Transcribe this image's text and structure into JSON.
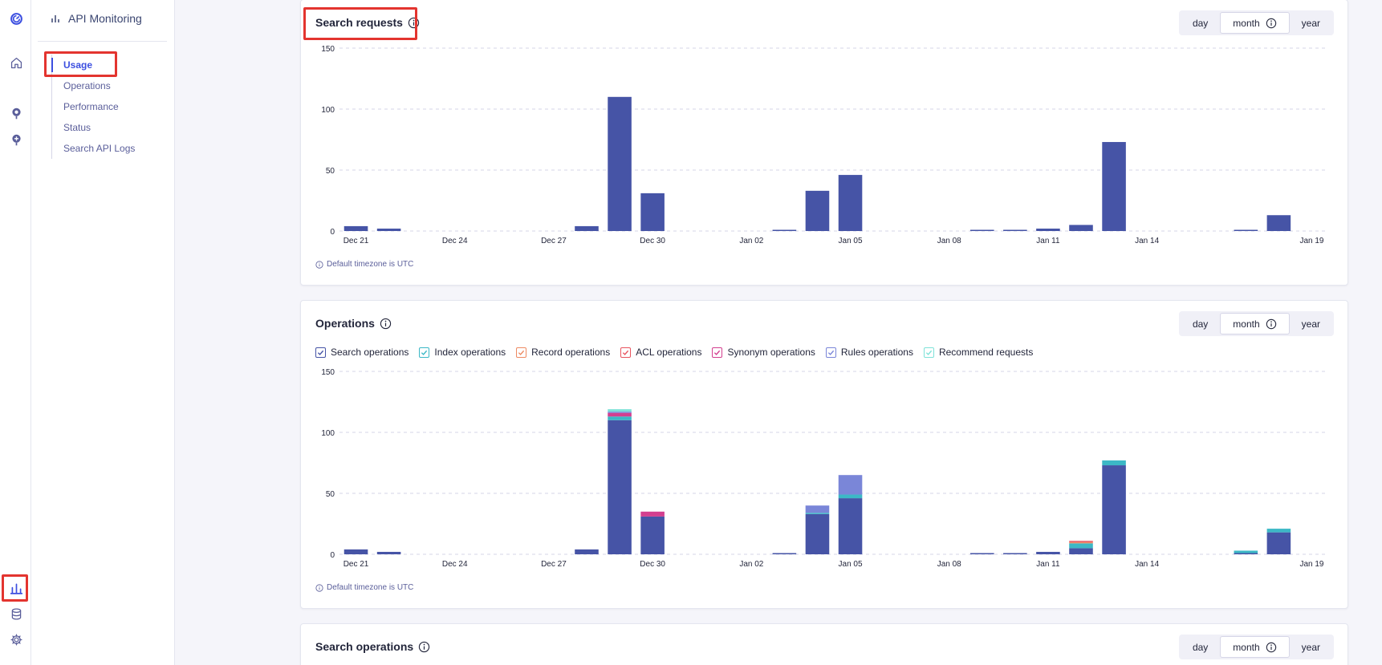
{
  "nav": {
    "title": "API Monitoring",
    "items": [
      {
        "label": "Usage",
        "active": true
      },
      {
        "label": "Operations",
        "active": false
      },
      {
        "label": "Performance",
        "active": false
      },
      {
        "label": "Status",
        "active": false
      },
      {
        "label": "Search API Logs",
        "active": false
      }
    ]
  },
  "rail": {
    "icons": [
      "algolia-logo-icon",
      "home-icon",
      "search-pin-icon",
      "add-pin-icon",
      "bar-chart-icon",
      "database-icon",
      "gear-icon"
    ],
    "active_icon": "bar-chart-icon"
  },
  "period_toggle": {
    "day": "day",
    "month": "month",
    "year": "year",
    "selected": "month"
  },
  "timezone_note": "Default timezone is UTC",
  "colors": {
    "accent": "#3c4fe0",
    "bar_primary": "#4654a6",
    "highlight_box": "#e3342f"
  },
  "cards": {
    "search_requests": {
      "title": "Search requests"
    },
    "operations": {
      "title": "Operations"
    },
    "search_operations": {
      "title": "Search operations"
    }
  },
  "legend": [
    {
      "label": "Search operations",
      "color": "#4654a6"
    },
    {
      "label": "Index operations",
      "color": "#3cb8c6"
    },
    {
      "label": "Record operations",
      "color": "#ee8a62"
    },
    {
      "label": "ACL operations",
      "color": "#e8535e"
    },
    {
      "label": "Synonym operations",
      "color": "#d33f8f"
    },
    {
      "label": "Rules operations",
      "color": "#7a86d8"
    },
    {
      "label": "Recommend requests",
      "color": "#7ee2d8"
    }
  ],
  "chart_data": [
    {
      "type": "bar",
      "title": "Search requests",
      "ylim": [
        0,
        150
      ],
      "yticks": [
        0,
        50,
        100,
        150
      ],
      "grid": true,
      "x_tick_labels": [
        "Dec 21",
        "Dec 24",
        "Dec 27",
        "Dec 30",
        "Jan 02",
        "Jan 05",
        "Jan 08",
        "Jan 11",
        "Jan 14",
        "Jan 19"
      ],
      "categories": [
        "Dec 21",
        "Dec 22",
        "Dec 23",
        "Dec 24",
        "Dec 25",
        "Dec 26",
        "Dec 27",
        "Dec 28",
        "Dec 29",
        "Dec 30",
        "Dec 31",
        "Jan 01",
        "Jan 02",
        "Jan 03",
        "Jan 04",
        "Jan 05",
        "Jan 06",
        "Jan 07",
        "Jan 08",
        "Jan 09",
        "Jan 10",
        "Jan 11",
        "Jan 12",
        "Jan 13",
        "Jan 14",
        "Jan 15",
        "Jan 16",
        "Jan 17",
        "Jan 18",
        "Jan 19"
      ],
      "series": [
        {
          "color": "#4654a6",
          "values": [
            4,
            2,
            0,
            0,
            0,
            0,
            0,
            4,
            110,
            31,
            0,
            0,
            0,
            1,
            33,
            46,
            0,
            0,
            0,
            1,
            1,
            2,
            5,
            73,
            0,
            0,
            0,
            1,
            13,
            0
          ]
        }
      ]
    },
    {
      "type": "bar",
      "title": "Operations",
      "stacked": true,
      "ylim": [
        0,
        150
      ],
      "yticks": [
        0,
        50,
        100,
        150
      ],
      "grid": true,
      "x_tick_labels": [
        "Dec 21",
        "Dec 24",
        "Dec 27",
        "Dec 30",
        "Jan 02",
        "Jan 05",
        "Jan 08",
        "Jan 11",
        "Jan 14",
        "Jan 19"
      ],
      "categories": [
        "Dec 21",
        "Dec 22",
        "Dec 23",
        "Dec 24",
        "Dec 25",
        "Dec 26",
        "Dec 27",
        "Dec 28",
        "Dec 29",
        "Dec 30",
        "Dec 31",
        "Jan 01",
        "Jan 02",
        "Jan 03",
        "Jan 04",
        "Jan 05",
        "Jan 06",
        "Jan 07",
        "Jan 08",
        "Jan 09",
        "Jan 10",
        "Jan 11",
        "Jan 12",
        "Jan 13",
        "Jan 14",
        "Jan 15",
        "Jan 16",
        "Jan 17",
        "Jan 18",
        "Jan 19"
      ],
      "series": [
        {
          "name": "Search operations",
          "color": "#4654a6",
          "values": [
            4,
            2,
            0,
            0,
            0,
            0,
            0,
            4,
            110,
            31,
            0,
            0,
            0,
            1,
            33,
            46,
            0,
            0,
            0,
            1,
            1,
            2,
            5,
            73,
            0,
            0,
            0,
            1,
            18,
            0
          ]
        },
        {
          "name": "Index operations",
          "color": "#3cb8c6",
          "values": [
            0,
            0,
            0,
            0,
            0,
            0,
            0,
            0,
            3,
            0,
            0,
            0,
            0,
            0,
            1,
            3,
            0,
            0,
            0,
            0,
            0,
            0,
            4,
            4,
            0,
            0,
            0,
            2,
            3,
            0
          ]
        },
        {
          "name": "Record operations",
          "color": "#ee8a62",
          "values": [
            0,
            0,
            0,
            0,
            0,
            0,
            0,
            0,
            0,
            0,
            0,
            0,
            0,
            0,
            0,
            0,
            0,
            0,
            0,
            0,
            0,
            0,
            1,
            0,
            0,
            0,
            0,
            0,
            0,
            0
          ]
        },
        {
          "name": "ACL operations",
          "color": "#e8535e",
          "values": [
            0,
            0,
            0,
            0,
            0,
            0,
            0,
            0,
            0,
            0,
            0,
            0,
            0,
            0,
            0,
            0,
            0,
            0,
            0,
            0,
            0,
            0,
            1,
            0,
            0,
            0,
            0,
            0,
            0,
            0
          ]
        },
        {
          "name": "Synonym operations",
          "color": "#d33f8f",
          "values": [
            0,
            0,
            0,
            0,
            0,
            0,
            0,
            0,
            3,
            4,
            0,
            0,
            0,
            0,
            0,
            0,
            0,
            0,
            0,
            0,
            0,
            0,
            0,
            0,
            0,
            0,
            0,
            0,
            0,
            0
          ]
        },
        {
          "name": "Rules operations",
          "color": "#7a86d8",
          "values": [
            0,
            0,
            0,
            0,
            0,
            0,
            0,
            0,
            1,
            0,
            0,
            0,
            0,
            0,
            6,
            16,
            0,
            0,
            0,
            0,
            0,
            0,
            0,
            0,
            0,
            0,
            0,
            0,
            0,
            0
          ]
        },
        {
          "name": "Recommend requests",
          "color": "#7ee2d8",
          "values": [
            0,
            0,
            0,
            0,
            0,
            0,
            0,
            0,
            2,
            0,
            0,
            0,
            0,
            0,
            0,
            0,
            0,
            0,
            0,
            0,
            0,
            0,
            0,
            0,
            0,
            0,
            0,
            0,
            0,
            0
          ]
        }
      ]
    }
  ]
}
